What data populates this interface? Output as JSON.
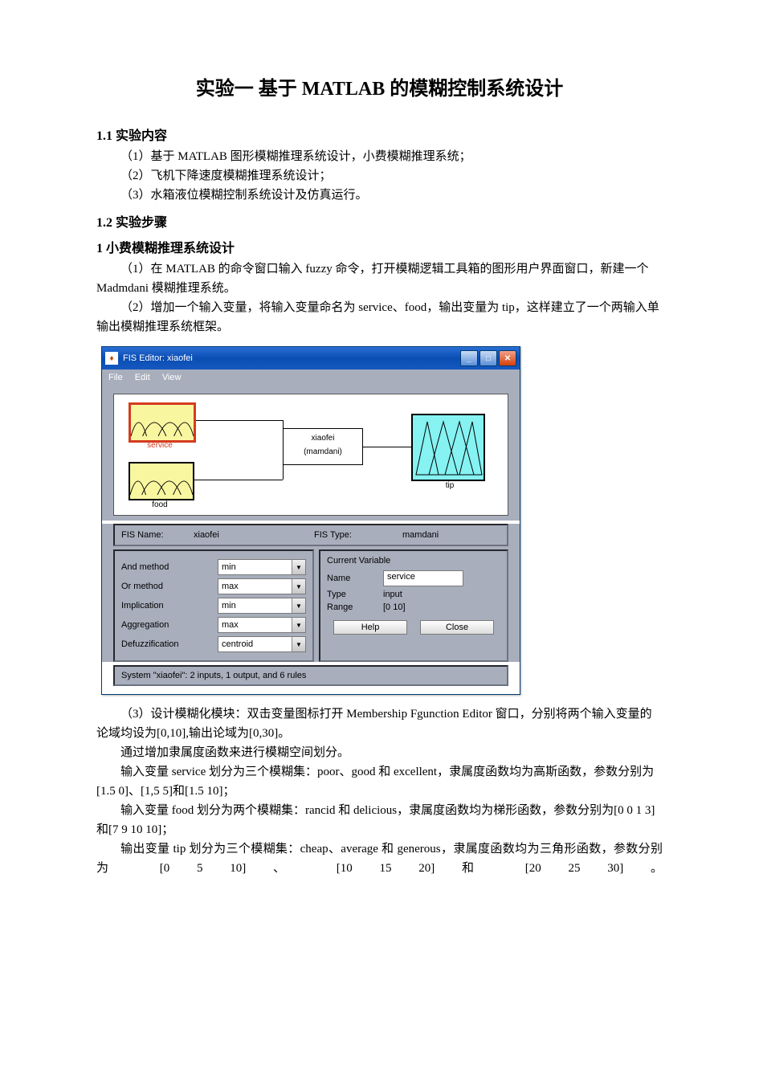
{
  "doc": {
    "title": "实验一 基于 MATLAB 的模糊控制系统设计",
    "s1_heading": "1.1 实验内容",
    "s1_items": [
      "（1）基于 MATLAB 图形模糊推理系统设计，小费模糊推理系统；",
      "（2）飞机下降速度模糊推理系统设计；",
      "（3）水箱液位模糊控制系统设计及仿真运行。"
    ],
    "s2_heading": "1.2 实验步骤",
    "s2_sub_heading": "1 小费模糊推理系统设计",
    "s2_p1": "（1）在 MATLAB 的命令窗口输入 fuzzy 命令，打开模糊逻辑工具箱的图形用户界面窗口，新建一个 Madmdani 模糊推理系统。",
    "s2_p2": "（2）增加一个输入变量，将输入变量命名为 service、food，输出变量为 tip，这样建立了一个两输入单输出模糊推理系统框架。",
    "after_img_p1": "（3）设计模糊化模块：双击变量图标打开 Membership Fgunction Editor 窗口，分别将两个输入变量的论域均设为[0,10],输出论域为[0,30]。",
    "after_img_p2": "通过增加隶属度函数来进行模糊空间划分。",
    "after_img_p3": "输入变量 service 划分为三个模糊集：poor、good 和 excellent，隶属度函数均为高斯函数，参数分别为[1.5 0]、[1,5 5]和[1.5 10]；",
    "after_img_p4": "输入变量 food 划分为两个模糊集：rancid 和 delicious，隶属度函数均为梯形函数，参数分别为[0 0 1 3]和[7 9 10 10]；",
    "after_img_p5": "输出变量 tip 划分为三个模糊集：cheap、average 和 generous，隶属度函数均为三角形函数，参数分别为 [0 5 10] 、 [10 15 20] 和 [20 25 30] 。"
  },
  "fis": {
    "window_title": "FIS Editor: xiaofei",
    "menu": {
      "file": "File",
      "edit": "Edit",
      "view": "View"
    },
    "diagram": {
      "input1": "service",
      "input2": "food",
      "system_name": "xiaofei",
      "system_type": "(mamdani)",
      "output": "tip"
    },
    "name_row": {
      "fis_name_label": "FIS Name:",
      "fis_name_value": "xiaofei",
      "fis_type_label": "FIS Type:",
      "fis_type_value": "mamdani"
    },
    "left": {
      "and": {
        "label": "And method",
        "value": "min"
      },
      "or": {
        "label": "Or method",
        "value": "max"
      },
      "imp": {
        "label": "Implication",
        "value": "min"
      },
      "agg": {
        "label": "Aggregation",
        "value": "max"
      },
      "defuzz": {
        "label": "Defuzzification",
        "value": "centroid"
      }
    },
    "right": {
      "heading": "Current Variable",
      "name_label": "Name",
      "name_value": "service",
      "type_label": "Type",
      "type_value": "input",
      "range_label": "Range",
      "range_value": "[0 10]",
      "help": "Help",
      "close": "Close"
    },
    "status": "System \"xiaofei\": 2 inputs, 1 output, and 6 rules"
  }
}
